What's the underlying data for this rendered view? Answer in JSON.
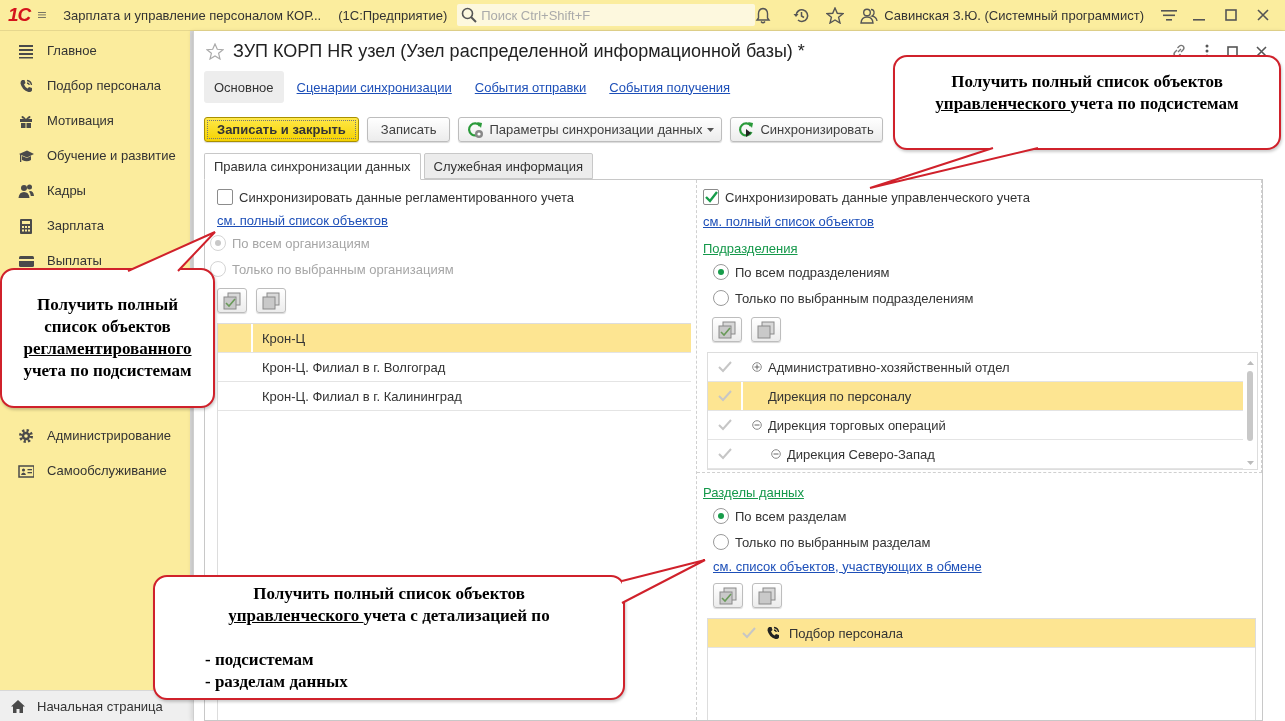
{
  "app_bar": {
    "logo": "1С",
    "title": "Зарплата и управление персоналом КОР...",
    "platform": "(1С:Предприятие)",
    "search": {
      "placeholder": "Поиск Ctrl+Shift+F"
    },
    "user": "Савинская З.Ю. (Системный программист)"
  },
  "sidebar": {
    "sections": [
      [
        {
          "label": "Главное"
        },
        {
          "label": "Подбор персонала"
        },
        {
          "label": "Мотивация"
        },
        {
          "label": "Обучение и развитие"
        },
        {
          "label": "Кадры"
        },
        {
          "label": "Зарплата"
        },
        {
          "label": "Выплаты"
        }
      ],
      [
        {
          "label": "Администрирование"
        },
        {
          "label": "Самообслуживание"
        }
      ]
    ],
    "home": "Начальная страница"
  },
  "form": {
    "title": "ЗУП КОРП HR узел (Узел распределенной информационной базы) *",
    "nav": [
      {
        "label": "Основное",
        "selected": true
      },
      {
        "label": "Сценарии синхронизации",
        "selected": false
      },
      {
        "label": "События отправки",
        "selected": false
      },
      {
        "label": "События получения",
        "selected": false
      }
    ],
    "toolbar": [
      {
        "label": "Записать и закрыть",
        "kind": "default"
      },
      {
        "label": "Записать",
        "kind": "plain"
      },
      {
        "label": "Параметры синхронизации данных",
        "kind": "menu"
      },
      {
        "label": "Синхронизировать",
        "kind": "sync"
      }
    ],
    "tabs": [
      {
        "label": "Правила синхронизации данных",
        "selected": true
      },
      {
        "label": "Служебная информация",
        "selected": false
      }
    ]
  },
  "regulated": {
    "checkbox": {
      "label": "Синхронизировать данные регламентированного учета",
      "checked": false
    },
    "link": "см. полный список объектов",
    "disabled": true,
    "radios": [
      {
        "label": "По всем организациям",
        "selected": true
      },
      {
        "label": "Только по выбранным организациям",
        "selected": false
      }
    ],
    "rows": [
      {
        "name": "Крон-Ц",
        "selected": true
      },
      {
        "name": "Крон-Ц. Филиал в г. Волгоград",
        "selected": false
      },
      {
        "name": "Крон-Ц. Филиал в г. Калининград",
        "selected": false
      }
    ]
  },
  "management": {
    "checkbox": {
      "label": "Синхронизировать данные управленческого учета",
      "checked": true
    },
    "link": "см. полный список объектов",
    "departments": {
      "heading": "Подразделения",
      "radios": [
        {
          "label": "По всем подразделениям",
          "selected": true
        },
        {
          "label": "Только по выбранным подразделениям",
          "selected": false
        }
      ],
      "tree": [
        {
          "name": "Административно-хозяйственный отдел",
          "kind": "group",
          "expanded": false,
          "checked": true,
          "selected": false
        },
        {
          "name": "Дирекция по персоналу",
          "kind": "leaf",
          "checked": true,
          "selected": true
        },
        {
          "name": "Дирекция торговых операций",
          "kind": "group",
          "expanded": true,
          "checked": true,
          "selected": false,
          "children": [
            {
              "name": "Дирекция Северо-Запад",
              "kind": "group",
              "expanded": true,
              "checked": true,
              "selected": false
            }
          ]
        }
      ]
    },
    "data_sections": {
      "heading": "Разделы данных",
      "radios": [
        {
          "label": "По всем разделам",
          "selected": true
        },
        {
          "label": "Только по выбранным разделам",
          "selected": false
        }
      ],
      "link": "см. список объектов, участвующих в обмене",
      "rows": [
        {
          "name": "Подбор персонала",
          "checked": true,
          "selected": true
        }
      ]
    }
  },
  "callouts": [
    {
      "segments": [
        {
          "text": "Получить полный список объектов ",
          "underline": false
        },
        {
          "text": "управленческого ",
          "underline": true
        },
        {
          "text": "учета по подсистемам",
          "underline": false
        }
      ]
    },
    {
      "segments": [
        {
          "text": "Получить полный список объектов ",
          "underline": false
        },
        {
          "text": "регламентированного",
          "underline": true
        },
        {
          "text": " учета по подсистемам",
          "underline": false
        }
      ]
    },
    {
      "segments": [
        {
          "text": "Получить полный список объектов ",
          "underline": false
        },
        {
          "text": "управленческого ",
          "underline": true
        },
        {
          "text": "учета с детализацией по",
          "underline": false
        }
      ],
      "list": [
        "- подсистемам",
        "- разделам данных"
      ]
    }
  ]
}
